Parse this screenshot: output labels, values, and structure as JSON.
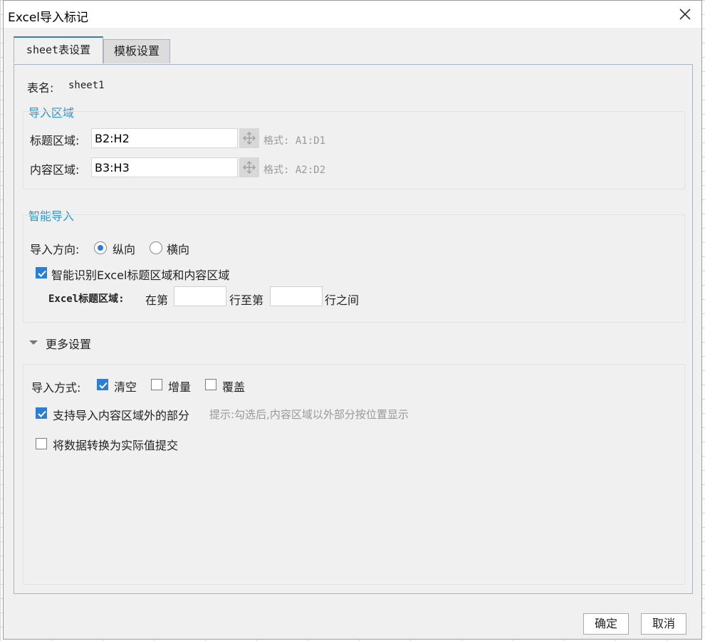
{
  "dialog": {
    "title": "Excel导入标记"
  },
  "tabs": [
    {
      "label": "sheet表设置",
      "active": true
    },
    {
      "label": "模板设置",
      "active": false
    }
  ],
  "sheet": {
    "name_label": "表名:",
    "name_value": "sheet1"
  },
  "import_area": {
    "title": "导入区域",
    "title_field": {
      "label": "标题区域:",
      "value": "B2:H2",
      "hint": "格式: A1:D1"
    },
    "content_field": {
      "label": "内容区域:",
      "value": "B3:H3",
      "hint": "格式: A2:D2"
    }
  },
  "smart_import": {
    "title": "智能导入",
    "direction_label": "导入方向:",
    "direction_options": [
      {
        "label": "纵向",
        "checked": true
      },
      {
        "label": "横向",
        "checked": false
      }
    ],
    "auto_detect": {
      "label": "智能识别Excel标题区域和内容区域",
      "checked": true
    },
    "range_prefix": "Excel标题区域:",
    "range_text_1": "在第",
    "range_text_2": "行至第",
    "range_text_3": "行之间"
  },
  "more_settings": {
    "title": "更多设置",
    "method_label": "导入方式:",
    "methods": [
      {
        "label": "清空",
        "checked": true
      },
      {
        "label": "增量",
        "checked": false
      },
      {
        "label": "覆盖",
        "checked": false
      }
    ],
    "outside_content": {
      "label": "支持导入内容区域外的部分",
      "checked": true,
      "hint": "提示:勾选后,内容区域以外部分按位置显示"
    },
    "convert_values": {
      "label": "将数据转换为实际值提交",
      "checked": false
    }
  },
  "buttons": {
    "ok": "确定",
    "cancel": "取消"
  },
  "colors": {
    "accent": "#2a7ed3",
    "group_title": "#2a95cf",
    "tab_accent": "#2b7cd3"
  }
}
